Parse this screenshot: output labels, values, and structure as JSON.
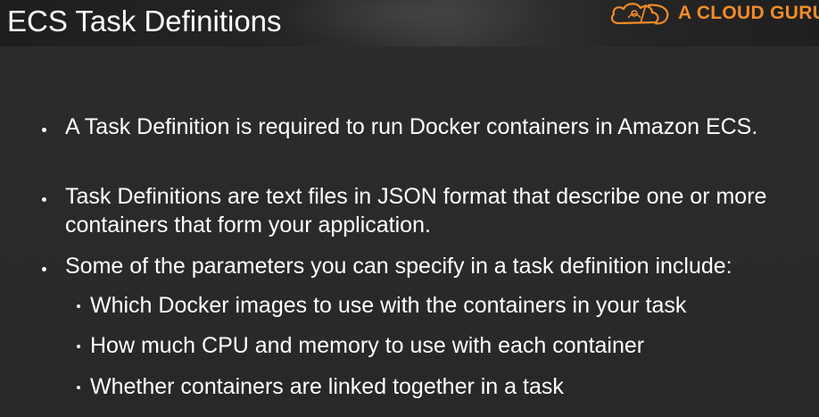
{
  "slide": {
    "title": "ECS Task Definitions",
    "logo": {
      "text": "A CLOUD GURU",
      "icon": "cloud-icon",
      "color": "#f28c28"
    },
    "bullets": [
      {
        "text": "A Task Definition is required to run Docker containers in Amazon ECS."
      },
      {
        "text": "Task Definitions are text files in JSON format that describe one or more containers that form your application."
      },
      {
        "text": "Some of the parameters you can specify in a task definition include:"
      }
    ],
    "sub_bullets": [
      {
        "text": "Which Docker images to use with the containers in your task"
      },
      {
        "text": "How much CPU and memory to use with each container"
      },
      {
        "text": "Whether containers are linked together in a task"
      }
    ]
  }
}
